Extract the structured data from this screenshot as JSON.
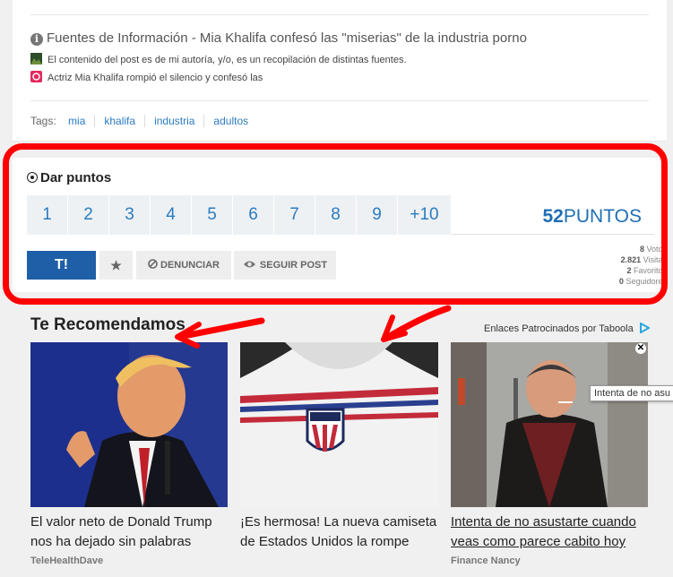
{
  "sources": {
    "title": "Fuentes de Información - Mia Khalifa confesó las \"miserias\" de la industria porno",
    "line1": "El contenido del post es de mi autoría, y/o, es un recopilación de distintas fuentes.",
    "line2": "Actriz Mia Khalifa rompió el silencio y confesó las"
  },
  "tags": {
    "label": "Tags:",
    "items": [
      "mia",
      "khalifa",
      "industria",
      "adultos"
    ]
  },
  "points": {
    "title": "Dar puntos",
    "options": [
      "1",
      "2",
      "3",
      "4",
      "5",
      "6",
      "7",
      "8",
      "9",
      "+10"
    ],
    "score_value": "52",
    "score_unit": "PUNTOS"
  },
  "actions": {
    "t_label": "T!",
    "denunciar": "DENUNCIAR",
    "seguir": "SEGUIR POST"
  },
  "stats": {
    "votos_n": "8",
    "votos_l": "Votos",
    "visitas_n": "2.821",
    "visitas_l": "Visitas",
    "favoritos_n": "2",
    "favoritos_l": "Favoritos",
    "seguidores_n": "0",
    "seguidores_l": "Seguidores"
  },
  "recommend": {
    "title": "Te Recomendamos",
    "sponsored": "Enlaces Patrocinados por Taboola",
    "tooltip": "Intenta de no asu",
    "items": [
      {
        "headline": "El valor neto de Donald Trump nos ha dejado sin palabras",
        "brand": "TeleHealthDave"
      },
      {
        "headline": "¡Es hermosa! La nueva camiseta de Estados Unidos la rompe",
        "brand": ""
      },
      {
        "headline": "Intenta de no asustarte cuando veas como parece cabito hoy",
        "brand": "Finance Nancy"
      }
    ]
  },
  "colors": {
    "accent": "#2b7bc0",
    "primary_button": "#1f5fa8",
    "annotation": "#ff0000"
  }
}
